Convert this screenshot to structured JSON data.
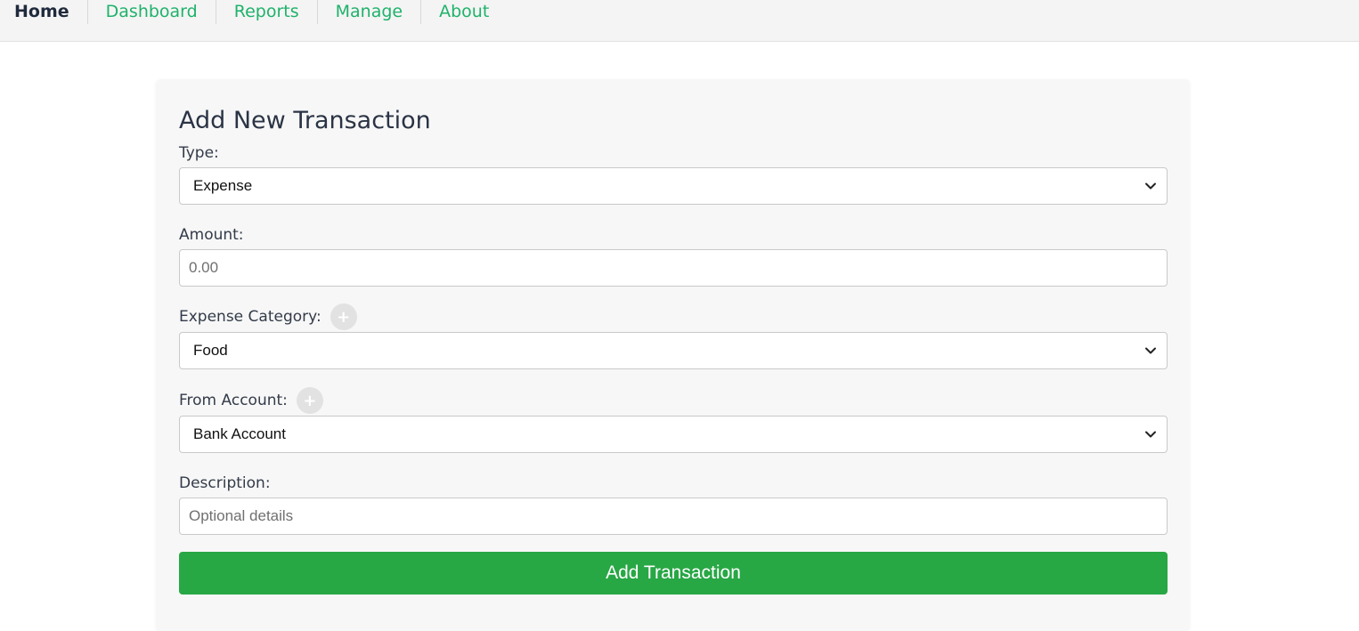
{
  "nav": {
    "items": [
      {
        "label": "Home"
      },
      {
        "label": "Dashboard"
      },
      {
        "label": "Reports"
      },
      {
        "label": "Manage"
      },
      {
        "label": "About"
      }
    ],
    "active_color": "#1f2a3c",
    "link_color": "#1fb26b"
  },
  "form": {
    "title": "Add New Transaction",
    "type": {
      "label": "Type:",
      "selected": "Expense"
    },
    "amount": {
      "label": "Amount:",
      "value": "",
      "placeholder": "0.00"
    },
    "category": {
      "label": "Expense Category:",
      "add_icon": "plus-icon",
      "selected": "Food"
    },
    "account": {
      "label": "From Account:",
      "add_icon": "plus-icon",
      "selected": "Bank Account"
    },
    "description": {
      "label": "Description:",
      "value": "",
      "placeholder": "Optional details"
    },
    "submit_label": "Add Transaction",
    "submit_color": "#28a745"
  }
}
